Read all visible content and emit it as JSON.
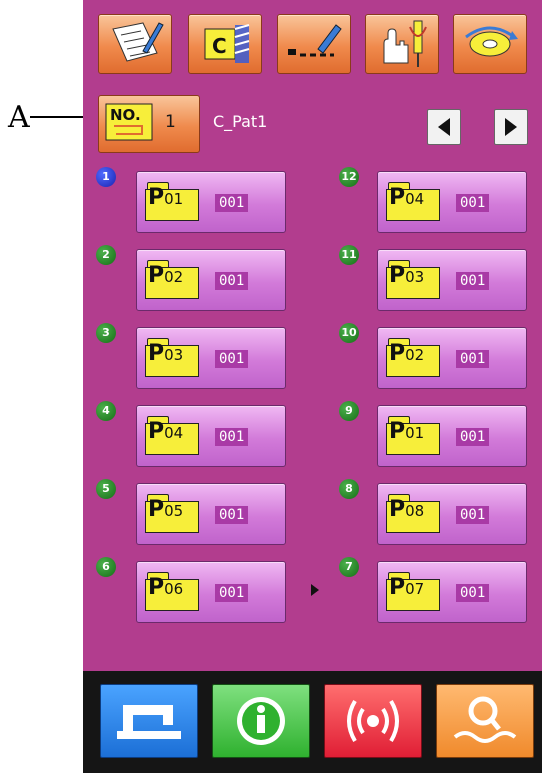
{
  "annotation": {
    "letter": "A"
  },
  "toolbar": {
    "items": [
      {
        "icon": "checklist-edit-icon"
      },
      {
        "icon": "cycle-pattern-icon",
        "letter": "C"
      },
      {
        "icon": "stitch-edit-icon"
      },
      {
        "icon": "hand-needle-icon"
      },
      {
        "icon": "bobbin-winding-icon"
      }
    ]
  },
  "pattern_no": {
    "label": "NO.",
    "value": "1",
    "name": "C_Pat1"
  },
  "nav": {
    "prev_icon": "triangle-left-icon",
    "next_icon": "triangle-right-icon"
  },
  "cells": [
    {
      "step": "1",
      "p": "P",
      "num": "01",
      "count": "001",
      "color": "blue"
    },
    {
      "step": "2",
      "p": "P",
      "num": "02",
      "count": "001",
      "color": "green"
    },
    {
      "step": "3",
      "p": "P",
      "num": "03",
      "count": "001",
      "color": "green"
    },
    {
      "step": "4",
      "p": "P",
      "num": "04",
      "count": "001",
      "color": "green"
    },
    {
      "step": "5",
      "p": "P",
      "num": "05",
      "count": "001",
      "color": "green"
    },
    {
      "step": "6",
      "p": "P",
      "num": "06",
      "count": "001",
      "color": "green"
    },
    {
      "step": "12",
      "p": "P",
      "num": "04",
      "count": "001",
      "color": "green"
    },
    {
      "step": "11",
      "p": "P",
      "num": "03",
      "count": "001",
      "color": "green"
    },
    {
      "step": "10",
      "p": "P",
      "num": "02",
      "count": "001",
      "color": "green"
    },
    {
      "step": "9",
      "p": "P",
      "num": "01",
      "count": "001",
      "color": "green"
    },
    {
      "step": "8",
      "p": "P",
      "num": "08",
      "count": "001",
      "color": "green"
    },
    {
      "step": "7",
      "p": "P",
      "num": "07",
      "count": "001",
      "color": "green"
    }
  ],
  "bottom": [
    {
      "icon": "sewing-machine-icon"
    },
    {
      "icon": "info-icon"
    },
    {
      "icon": "signal-alarm-icon"
    },
    {
      "icon": "search-thread-icon"
    }
  ],
  "colors": {
    "screen": "#b23d8e",
    "pattern_button": "#d27ad9",
    "folder": "#f7ee3a",
    "toolbar_button": "#f08a4c"
  }
}
